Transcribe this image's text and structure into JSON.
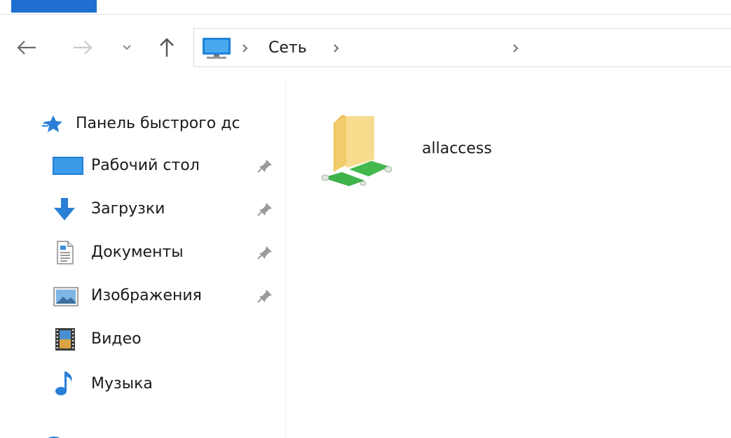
{
  "address": {
    "location_icon": "computer-icon",
    "segment": "Сеть"
  },
  "nav": {
    "back": "back-arrow-icon",
    "forward": "forward-arrow-icon",
    "recent": "chevron-down-icon",
    "up": "up-arrow-icon"
  },
  "sidebar": {
    "quick_access": "Панель быстрого дс",
    "items": [
      {
        "label": "Рабочий стол",
        "icon": "desktop-icon",
        "pinned": true
      },
      {
        "label": "Загрузки",
        "icon": "download-icon",
        "pinned": true
      },
      {
        "label": "Документы",
        "icon": "documents-icon",
        "pinned": true
      },
      {
        "label": "Изображения",
        "icon": "pictures-icon",
        "pinned": true
      },
      {
        "label": "Видео",
        "icon": "video-icon",
        "pinned": false
      },
      {
        "label": "Музыка",
        "icon": "music-icon",
        "pinned": false
      }
    ]
  },
  "content": {
    "items": [
      {
        "name": "allaccess",
        "icon": "network-share-folder-icon"
      }
    ]
  },
  "colors": {
    "accent": "#1e6fcf",
    "folder": "#f3d27a",
    "network_pipe": "#3fb24a"
  }
}
